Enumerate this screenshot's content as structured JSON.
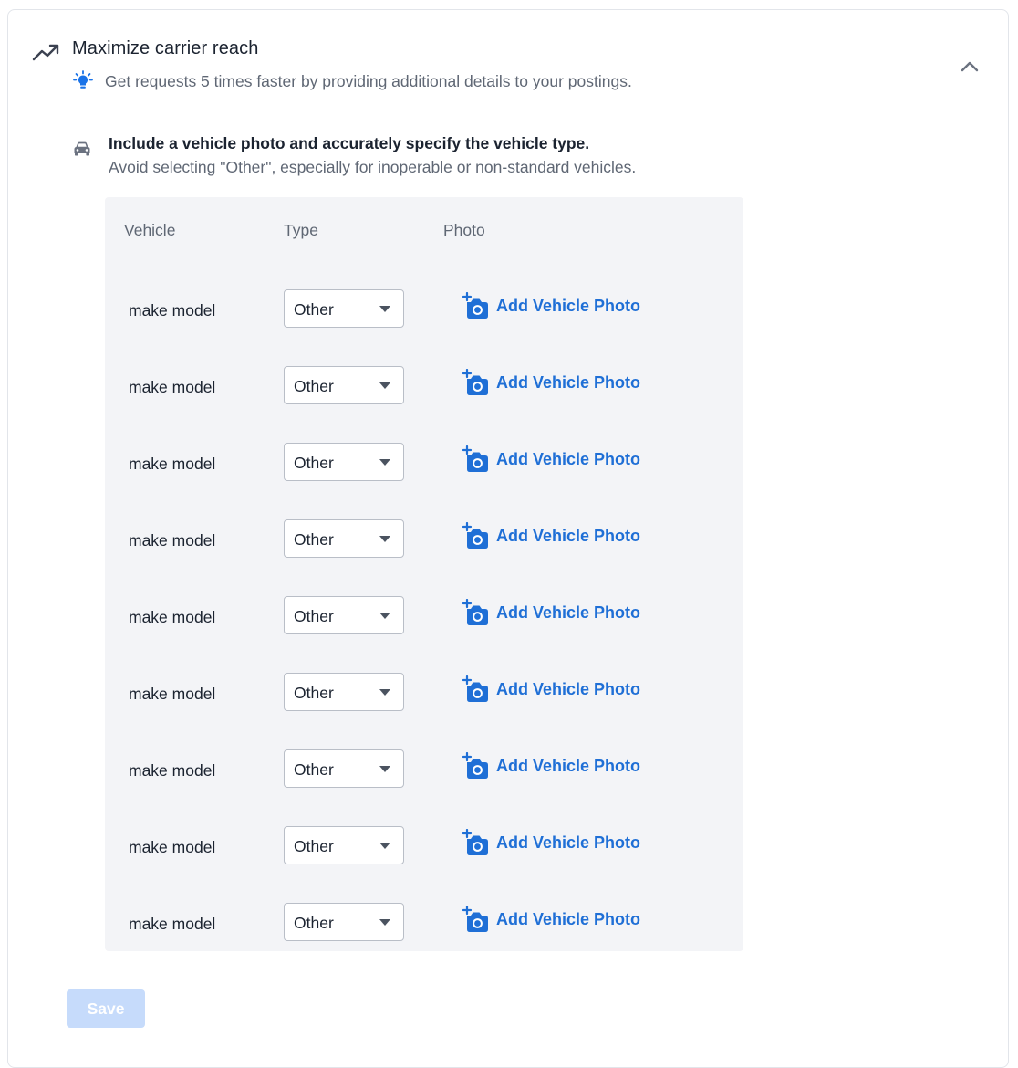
{
  "section": {
    "title": "Maximize carrier reach",
    "subtitle": "Get requests 5 times faster by providing additional details to your postings."
  },
  "recommendation": {
    "title": "Include a vehicle photo and accurately specify the vehicle type.",
    "description": "Avoid selecting \"Other\", especially for inoperable or non-standard vehicles."
  },
  "table": {
    "headers": {
      "vehicle": "Vehicle",
      "type": "Type",
      "photo": "Photo"
    },
    "rows": [
      {
        "vehicle": "make model",
        "type": "Other",
        "photo_action": "Add Vehicle Photo"
      },
      {
        "vehicle": "make model",
        "type": "Other",
        "photo_action": "Add Vehicle Photo"
      },
      {
        "vehicle": "make model",
        "type": "Other",
        "photo_action": "Add Vehicle Photo"
      },
      {
        "vehicle": "make model",
        "type": "Other",
        "photo_action": "Add Vehicle Photo"
      },
      {
        "vehicle": "make model",
        "type": "Other",
        "photo_action": "Add Vehicle Photo"
      },
      {
        "vehicle": "make model",
        "type": "Other",
        "photo_action": "Add Vehicle Photo"
      },
      {
        "vehicle": "make model",
        "type": "Other",
        "photo_action": "Add Vehicle Photo"
      },
      {
        "vehicle": "make model",
        "type": "Other",
        "photo_action": "Add Vehicle Photo"
      },
      {
        "vehicle": "make model",
        "type": "Other",
        "photo_action": "Add Vehicle Photo"
      }
    ]
  },
  "actions": {
    "save_label": "Save",
    "save_disabled": true
  },
  "icons": {
    "section": "trending-up-icon",
    "tip": "lightbulb-icon",
    "recommendation": "car-icon",
    "collapse": "chevron-up-icon",
    "photo": "add-camera-icon"
  },
  "colors": {
    "accent": "#1f6fd6",
    "tip": "#1a73e8",
    "save_disabled_bg": "#c6dbfb",
    "panel_bg": "#f3f4f7"
  }
}
